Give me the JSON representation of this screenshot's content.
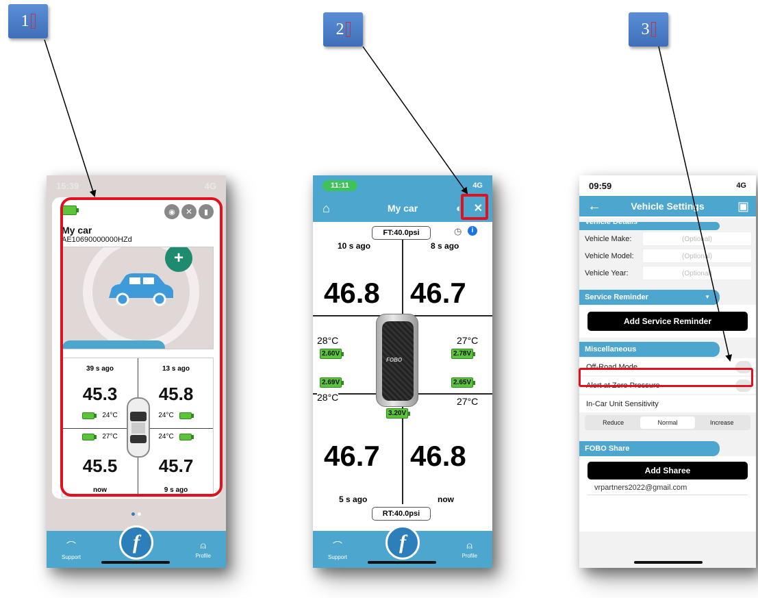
{
  "steps": [
    "1",
    "2",
    "3"
  ],
  "screen1": {
    "time": "15:39",
    "signal": "4G",
    "car_name": "My car",
    "car_id": "AE10690000000HZd",
    "cells": [
      {
        "ago": "39 s ago",
        "value": "45.3",
        "temp": "24°C"
      },
      {
        "ago": "13 s ago",
        "value": "45.8",
        "temp": "24°C"
      },
      {
        "ago": "now",
        "value": "45.5",
        "temp": "27°C"
      },
      {
        "ago": "9 s ago",
        "value": "45.7",
        "temp": "24°C"
      }
    ],
    "tabs": {
      "support": "Support",
      "profile": "Profile"
    }
  },
  "screen2": {
    "time": "11:11",
    "signal": "4G",
    "title": "My car",
    "front_target": "FT:40.0psi",
    "rear_target": "RT:40.0psi",
    "tires": [
      {
        "ago": "10 s ago",
        "value": "46.8",
        "temp": "28°C",
        "volt": "2.60V"
      },
      {
        "ago": "8 s ago",
        "value": "46.7",
        "temp": "27°C",
        "volt": "2.78V"
      },
      {
        "ago": "5 s ago",
        "value": "46.7",
        "temp": "28°C",
        "volt": "2.69V"
      },
      {
        "ago": "now",
        "value": "46.8",
        "temp": "27°C",
        "volt": "2.65V"
      }
    ],
    "unit_volt": "3.20V",
    "brand": "FOBO",
    "tabs": {
      "support": "Support",
      "profile": "Profile"
    }
  },
  "screen3": {
    "time": "09:59",
    "signal": "4G",
    "title": "Vehicle Settings",
    "vehicle_details": "Vehicle Details",
    "make_label": "Vehicle Make:",
    "model_label": "Vehicle Model:",
    "year_label": "Vehicle Year:",
    "optional": "(Optional)",
    "service_reminder": "Service Reminder",
    "add_service_reminder": "Add Service Reminder",
    "misc": "Miscellaneous",
    "off_road": "Off-Road Mode",
    "alert_zero": "Alert at Zero Pressure",
    "sensitivity": "In-Car Unit Sensitivity",
    "seg": [
      "Reduce",
      "Normal",
      "Increase"
    ],
    "fobo_share": "FOBO Share",
    "add_sharee": "Add Sharee",
    "email": "vrpartners2022@gmail.com"
  },
  "colors": {
    "accent": "#4ca6ce",
    "highlight": "#e0101f",
    "battery": "#5bc43a"
  }
}
